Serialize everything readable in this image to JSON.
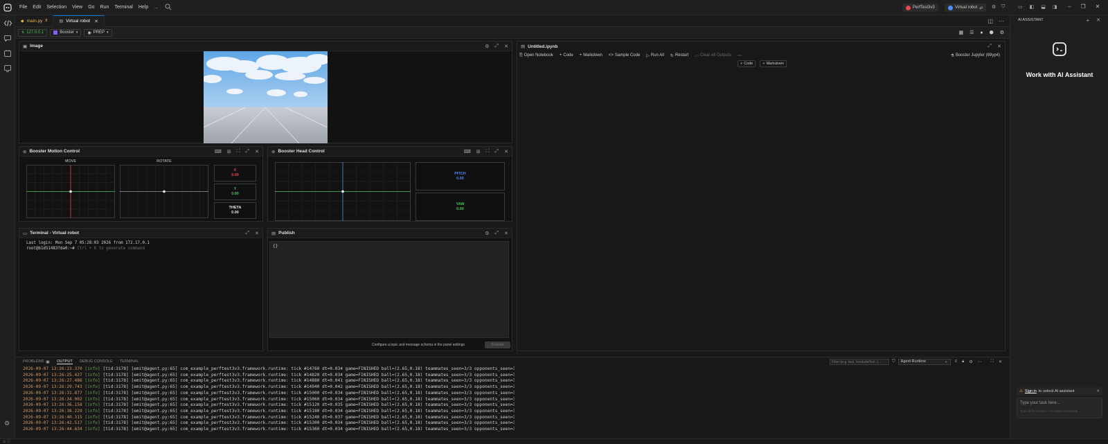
{
  "menu": [
    "File",
    "Edit",
    "Selection",
    "View",
    "Go",
    "Run",
    "Terminal",
    "Help"
  ],
  "titlebar": {
    "project": "PerfTest3v3",
    "robot": "Virtual robot"
  },
  "tabs": [
    {
      "label": "main.py",
      "badge": "8",
      "active": false
    },
    {
      "label": "Virtual robot",
      "active": true
    }
  ],
  "toolbar2": {
    "ip": "127.0.0.1",
    "robot": "Booster",
    "mode": "PREP"
  },
  "image_panel": {
    "title": "Image"
  },
  "notebook": {
    "title": "Untitled.ipynb",
    "actions": [
      "Open Notebook",
      "Code",
      "Markdown",
      "Sample Code",
      "Run All",
      "Restart",
      "Clear All Outputs"
    ],
    "kernel": "Booster Jupyter (69yp4)",
    "add_code": "Code",
    "add_markdown": "Markdown"
  },
  "motion": {
    "title": "Booster Motion Control",
    "move_label": "MOVE",
    "rotate_label": "ROTATE",
    "x_label": "X",
    "x_value": "0.00",
    "y_label": "Y",
    "y_value": "0.00",
    "theta_label": "THETA",
    "theta_value": "0.00"
  },
  "head": {
    "title": "Booster Head Control",
    "pitch_label": "PITCH",
    "pitch_value": "0.00",
    "yaw_label": "YAW",
    "yaw_value": "0.00"
  },
  "terminal": {
    "title": "Terminal - Virtual robot",
    "line1": "Last login: Mon Sep  7 05:28:03 2026 from 172.17.0.1",
    "prompt": "root@b1d51483fda0:~#",
    "hint": "Ctrl + K to generate command"
  },
  "publish": {
    "title": "Publish",
    "editor_text": "{}",
    "hint": "Configure a topic and message schema in the panel settings",
    "button": "Publish"
  },
  "bottom": {
    "tabs": [
      "PROBLEMS",
      "OUTPUT",
      "DEBUG CONSOLE",
      "TERMINAL"
    ],
    "problems_count": "6",
    "filter_placeholder": "Filter (e.g. text, !excludeText, t...",
    "channel": "Agent Runtime"
  },
  "logs": [
    {
      "ts": "2026-09-07 13:26:23.370",
      "lvl": "[info]",
      "msg": "[tid:3178] [emit@agent.py:65] com_example_perftest3v3.framework.runtime: tick #14760 dt=0.034 game=FINISHED ball=(2.65,0.18) teammates_seen=3/3 opponents_seen=3/3"
    },
    {
      "ts": "2026-09-07 13:26:25.427",
      "lvl": "[info]",
      "msg": "[tid:3178] [emit@agent.py:65] com_example_perftest3v3.framework.runtime: tick #14820 dt=0.034 game=FINISHED ball=(2.65,0.18) teammates_seen=3/3 opponents_seen=3/3"
    },
    {
      "ts": "2026-09-07 13:26:27.486",
      "lvl": "[info]",
      "msg": "[tid:3178] [emit@agent.py:65] com_example_perftest3v3.framework.runtime: tick #14880 dt=0.041 game=FINISHED ball=(2.65,0.18) teammates_seen=3/3 opponents_seen=3/3"
    },
    {
      "ts": "2026-09-07 13:26:29.743",
      "lvl": "[info]",
      "msg": "[tid:3178] [emit@agent.py:65] com_example_perftest3v3.framework.runtime: tick #14940 dt=0.042 game=FINISHED ball=(2.65,0.18) teammates_seen=3/3 opponents_seen=3/3"
    },
    {
      "ts": "2026-09-07 13:26:31.877",
      "lvl": "[info]",
      "msg": "[tid:3178] [emit@agent.py:65] com_example_perftest3v3.framework.runtime: tick #15000 dt=0.034 game=FINISHED ball=(2.65,0.18) teammates_seen=3/3 opponents_seen=3/3"
    },
    {
      "ts": "2026-09-07 13:26:34.002",
      "lvl": "[info]",
      "msg": "[tid:3178] [emit@agent.py:65] com_example_perftest3v3.framework.runtime: tick #15060 dt=0.034 game=FINISHED ball=(2.65,0.18) teammates_seen=3/3 opponents_seen=3/3"
    },
    {
      "ts": "2026-09-07 13:26:36.158",
      "lvl": "[info]",
      "msg": "[tid:3178] [emit@agent.py:65] com_example_perftest3v3.framework.runtime: tick #15120 dt=0.035 game=FINISHED ball=(2.65,0.18) teammates_seen=3/3 opponents_seen=3/3"
    },
    {
      "ts": "2026-09-07 13:26:38.229",
      "lvl": "[info]",
      "msg": "[tid:3178] [emit@agent.py:65] com_example_perftest3v3.framework.runtime: tick #15180 dt=0.034 game=FINISHED ball=(2.65,0.18) teammates_seen=3/3 opponents_seen=3/3"
    },
    {
      "ts": "2026-09-07 13:26:40.315",
      "lvl": "[info]",
      "msg": "[tid:3178] [emit@agent.py:65] com_example_perftest3v3.framework.runtime: tick #15240 dt=0.037 game=FINISHED ball=(2.65,0.18) teammates_seen=3/3 opponents_seen=3/3"
    },
    {
      "ts": "2026-09-07 13:26:42.517",
      "lvl": "[info]",
      "msg": "[tid:3178] [emit@agent.py:65] com_example_perftest3v3.framework.runtime: tick #15300 dt=0.034 game=FINISHED ball=(2.65,0.18) teammates_seen=3/3 opponents_seen=3/3"
    },
    {
      "ts": "2026-09-07 13:26:44.634",
      "lvl": "[info]",
      "msg": "[tid:3178] [emit@agent.py:65] com_example_perftest3v3.framework.runtime: tick #15360 dt=0.034 game=FINISHED ball=(2.65,0.18) teammates_seen=3/3 opponents_seen=3/3"
    }
  ],
  "ai": {
    "header": "AI ASSISTANT",
    "title": "Work with AI Assistant",
    "signin_link": "Sign in",
    "signin_rest": "to unlock AI assistant",
    "input_placeholder": "Type your task here...",
    "input_hint": "Type @ for context, / for slash commands..."
  },
  "colors": {
    "accent": "#0078d4",
    "x": "#e5484d",
    "y": "#46c35a",
    "pitch": "#4d8cf5",
    "yaw": "#46c35a"
  },
  "icons": [
    "app-logo-icon",
    "search-icon",
    "files-icon",
    "chat-icon",
    "robot-icon",
    "monitor-icon",
    "settings-icon",
    "close-icon",
    "expand-icon",
    "gear-icon"
  ]
}
